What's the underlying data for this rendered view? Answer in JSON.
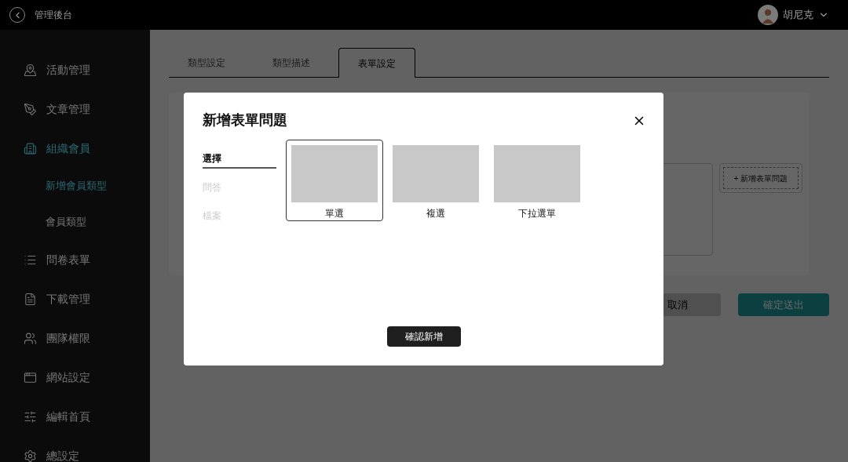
{
  "header": {
    "title": "管理後台",
    "user": "胡尼克"
  },
  "sidebar": {
    "items": [
      {
        "label": "活動管理",
        "selected": false
      },
      {
        "label": "文章管理",
        "selected": false
      },
      {
        "label": "組織會員",
        "selected": true,
        "children": [
          {
            "label": "新增會員類型",
            "selected": true
          },
          {
            "label": "會員類型",
            "selected": false
          }
        ]
      },
      {
        "label": "問卷表單",
        "selected": false
      },
      {
        "label": "下載管理",
        "selected": false
      },
      {
        "label": "團隊權限",
        "selected": false
      },
      {
        "label": "網站設定",
        "selected": false
      },
      {
        "label": "編輯首頁",
        "selected": false
      },
      {
        "label": "總設定",
        "selected": false
      }
    ]
  },
  "tabs": [
    {
      "label": "類型設定",
      "selected": false
    },
    {
      "label": "類型描述",
      "selected": false
    },
    {
      "label": "表單設定",
      "selected": true
    }
  ],
  "form_card": {
    "add_button": "+ 新增表單問題"
  },
  "actions": {
    "cancel": "取消",
    "submit": "確定送出"
  },
  "dialog": {
    "title": "新增表單問題",
    "categories": [
      {
        "label": "選擇",
        "selected": true
      },
      {
        "label": "問答",
        "selected": false
      },
      {
        "label": "檔案",
        "selected": false
      }
    ],
    "options": [
      {
        "label": "單選",
        "selected": true
      },
      {
        "label": "複選",
        "selected": false
      },
      {
        "label": "下拉選單",
        "selected": false
      }
    ],
    "confirm": "確認新增"
  }
}
